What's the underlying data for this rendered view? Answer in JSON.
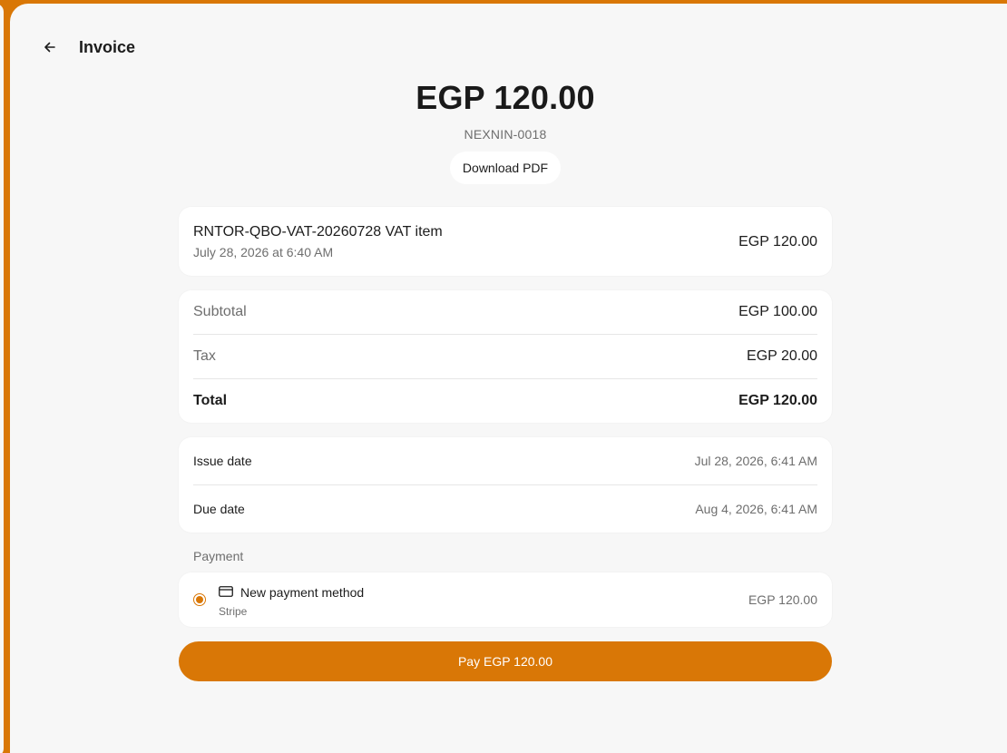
{
  "header": {
    "title": "Invoice",
    "back_icon": "arrow-left-icon"
  },
  "invoice": {
    "amount": "EGP 120.00",
    "number": "NEXNIN-0018",
    "download_label": "Download PDF"
  },
  "line_item": {
    "title": "RNTOR-QBO-VAT-20260728 VAT item",
    "date": "July 28, 2026 at 6:40 AM",
    "amount": "EGP 120.00"
  },
  "totals": {
    "subtotal_label": "Subtotal",
    "subtotal_value": "EGP 100.00",
    "tax_label": "Tax",
    "tax_value": "EGP 20.00",
    "total_label": "Total",
    "total_value": "EGP 120.00"
  },
  "dates": {
    "issue_label": "Issue date",
    "issue_value": "Jul 28, 2026, 6:41 AM",
    "due_label": "Due date",
    "due_value": "Aug 4, 2026, 6:41 AM"
  },
  "payment": {
    "section_label": "Payment",
    "method_name": "New payment method",
    "provider": "Stripe",
    "amount": "EGP 120.00",
    "selected": true,
    "icon": "credit-card-icon"
  },
  "pay_button_label": "Pay EGP 120.00",
  "colors": {
    "accent": "#d97706",
    "background": "#f7f7f7",
    "card": "#ffffff",
    "muted_text": "#6e6e6e"
  }
}
